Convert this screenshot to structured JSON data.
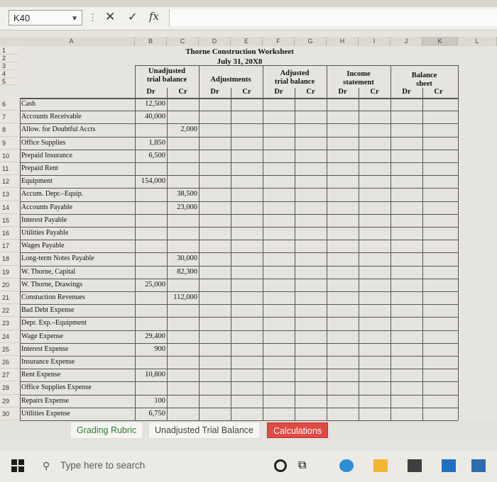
{
  "formula_bar": {
    "name_box": "K40",
    "fx_label": "fx",
    "formula": ""
  },
  "column_letters": [
    "A",
    "B",
    "C",
    "D",
    "E",
    "F",
    "G",
    "H",
    "I",
    "J",
    "K",
    "L"
  ],
  "worksheet": {
    "title": "Thorne Construction Worksheet",
    "date": "July 31, 20X8",
    "headers": {
      "unadjusted": [
        "Unadjusted",
        "trial balance"
      ],
      "adjustments": [
        "Adjustments"
      ],
      "adjusted": [
        "Adjusted",
        "trial balance"
      ],
      "income": [
        "Income",
        "statement"
      ],
      "balance": [
        "Balance",
        "sheet"
      ],
      "dr": "Dr",
      "cr": "Cr"
    },
    "rows": [
      {
        "n": "6",
        "account": "Cash",
        "dr": "12,500",
        "cr": ""
      },
      {
        "n": "7",
        "account": "Accounts Receivable",
        "dr": "40,000",
        "cr": ""
      },
      {
        "n": "8",
        "account": "Allow. for Doubtful Accts",
        "dr": "",
        "cr": "2,000"
      },
      {
        "n": "9",
        "account": "Office Supplies",
        "dr": "1,850",
        "cr": ""
      },
      {
        "n": "10",
        "account": "Prepaid Insurance",
        "dr": "6,500",
        "cr": ""
      },
      {
        "n": "11",
        "account": "Prepaid Rent",
        "dr": "",
        "cr": ""
      },
      {
        "n": "12",
        "account": "Equipment",
        "dr": "154,000",
        "cr": ""
      },
      {
        "n": "13",
        "account": "Accum. Depr.–Equip.",
        "dr": "",
        "cr": "38,500"
      },
      {
        "n": "14",
        "account": "Accounts Payable",
        "dr": "",
        "cr": "23,000"
      },
      {
        "n": "15",
        "account": "Interest Payable",
        "dr": "",
        "cr": ""
      },
      {
        "n": "16",
        "account": "Utilities Payable",
        "dr": "",
        "cr": ""
      },
      {
        "n": "17",
        "account": "Wages Payable",
        "dr": "",
        "cr": ""
      },
      {
        "n": "18",
        "account": "Long-term Notes Payable",
        "dr": "",
        "cr": "30,000"
      },
      {
        "n": "19",
        "account": "W. Thorne, Capital",
        "dr": "",
        "cr": "82,300"
      },
      {
        "n": "20",
        "account": "W. Thorne, Drawings",
        "dr": "25,000",
        "cr": ""
      },
      {
        "n": "21",
        "account": "Constuction Revenues",
        "dr": "",
        "cr": "112,000"
      },
      {
        "n": "22",
        "account": "Bad Debt Expense",
        "dr": "",
        "cr": ""
      },
      {
        "n": "23",
        "account": "Depr. Exp.–Equipment",
        "dr": "",
        "cr": ""
      },
      {
        "n": "24",
        "account": "Wage Expense",
        "dr": "29,400",
        "cr": ""
      },
      {
        "n": "25",
        "account": "Interest Expense",
        "dr": "900",
        "cr": ""
      },
      {
        "n": "26",
        "account": "Insurance Expense",
        "dr": "",
        "cr": ""
      },
      {
        "n": "27",
        "account": "Rent Expense",
        "dr": "10,800",
        "cr": ""
      },
      {
        "n": "28",
        "account": "Office Supplies Expense",
        "dr": "",
        "cr": ""
      },
      {
        "n": "29",
        "account": "Repairs Expense",
        "dr": "100",
        "cr": ""
      },
      {
        "n": "30",
        "account": "Utilities Expense",
        "dr": "6,750",
        "cr": ""
      }
    ],
    "header_row_numbers": [
      "1",
      "2",
      "3",
      "4",
      "5"
    ]
  },
  "sheet_tabs": [
    "Grading Rubric",
    "Unadjusted Trial Balance",
    "Calculations"
  ],
  "taskbar": {
    "search_placeholder": "Type here to search"
  },
  "icons": [
    "close-icon",
    "check-icon",
    "fx-icon",
    "windows-icon",
    "search-icon",
    "task-view-icon",
    "widgets-icon"
  ],
  "colors": {
    "active_tab_text": "#2f7d3a",
    "calculations_tab": "#e04a45"
  }
}
